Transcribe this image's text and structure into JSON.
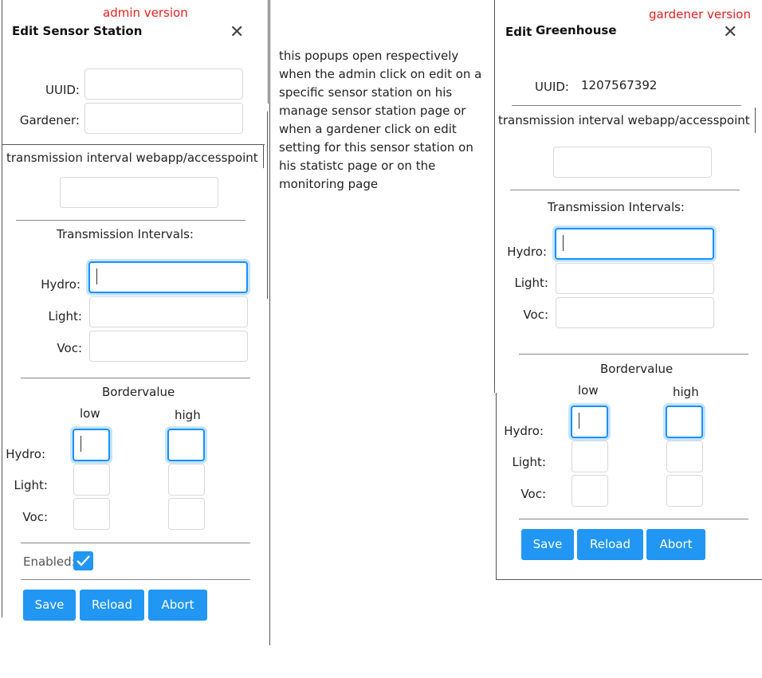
{
  "admin": {
    "tag": "admin version",
    "title": "Edit Sensor Station",
    "uuid_label": "UUID:",
    "gardener_label": "Gardener:",
    "transmission_text": "transmission interval webapp/accesspoint",
    "transmission_heading": "Transmission Intervals:",
    "hydro_label": "Hydro:",
    "light_label": "Light:",
    "voc_label": "Voc:",
    "border_heading": "Bordervalue",
    "low_label": "low",
    "high_label": "high",
    "enabled_label": "Enabled:",
    "enabled": true,
    "save": "Save",
    "reload": "Reload",
    "abort": "Abort"
  },
  "note": {
    "line1": "this popups open respectively",
    "line2": "when the admin click on edit on a",
    "line3": "specific sensor station on his",
    "line4": "manage sensor station page or",
    "line5": "when a gardener click on edit",
    "line6": "setting for this sensor station on",
    "line7": "his statistc page or on the",
    "line8": "monitoring page"
  },
  "gardener": {
    "tag": "gardener version",
    "title_edit": "Edit",
    "title_name": "Greenhouse",
    "uuid_label": "UUID:",
    "uuid_value": "1207567392",
    "transmission_text": "transmission interval webapp/accesspoint",
    "transmission_heading": "Transmission Intervals:",
    "hydro_label": "Hydro:",
    "light_label": "Light:",
    "voc_label": "Voc:",
    "border_heading": "Bordervalue",
    "low_label": "low",
    "high_label": "high",
    "save": "Save",
    "reload": "Reload",
    "abort": "Abort"
  },
  "icons": {
    "close": "close-icon",
    "check": "check-icon"
  },
  "colors": {
    "accent": "#2196f3",
    "tag": "#e02020",
    "focus": "#1890ff"
  }
}
